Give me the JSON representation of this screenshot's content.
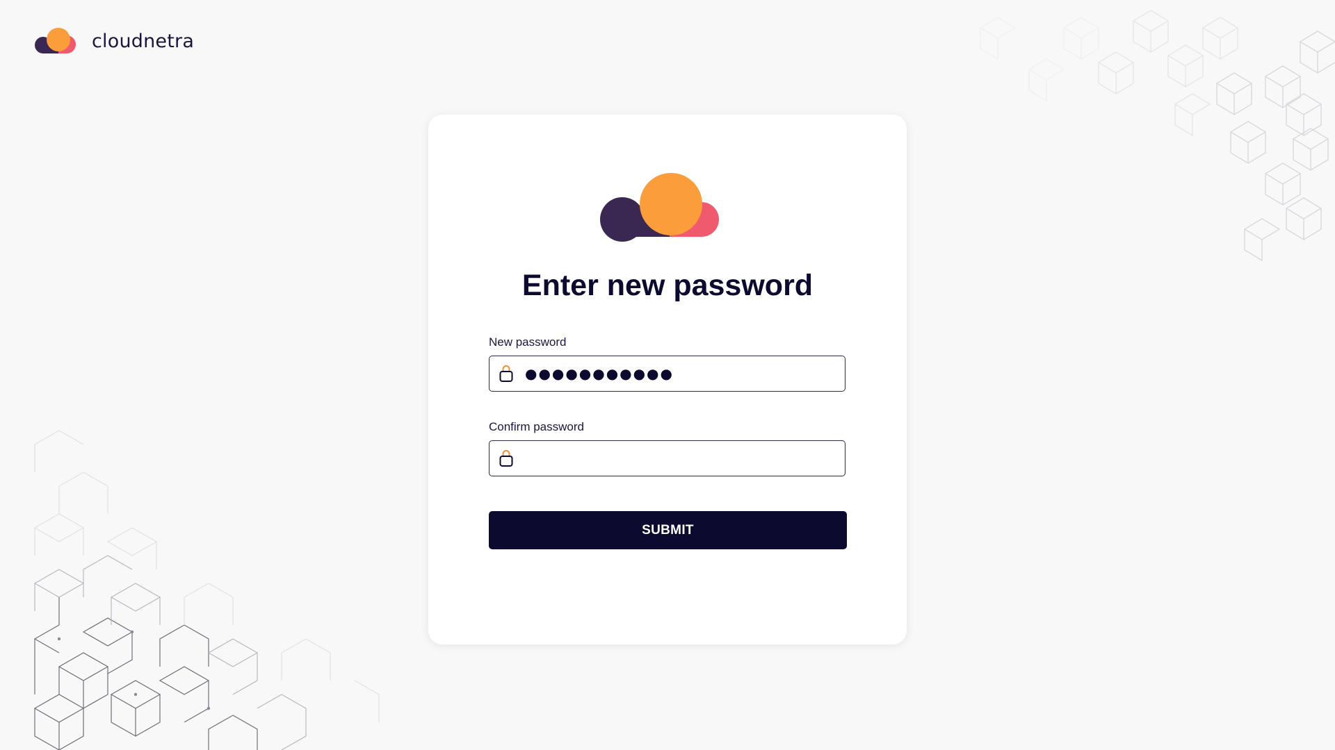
{
  "brand": {
    "name": "cloudnetra",
    "logo_icon": "cloud-logo-icon",
    "colors": {
      "dark": "#3a2752",
      "orange": "#fb9d3a",
      "pink": "#ef5a6f"
    }
  },
  "card": {
    "title": "Enter new password",
    "new_password": {
      "label": "New password",
      "value": "●●●●●●●●●●●",
      "icon": "lock-icon"
    },
    "confirm_password": {
      "label": "Confirm password",
      "value": "",
      "icon": "lock-icon"
    },
    "submit_label": "SUBMIT"
  },
  "colors": {
    "primary": "#0c0a2e",
    "background": "#f8f8f9",
    "card": "#ffffff"
  }
}
